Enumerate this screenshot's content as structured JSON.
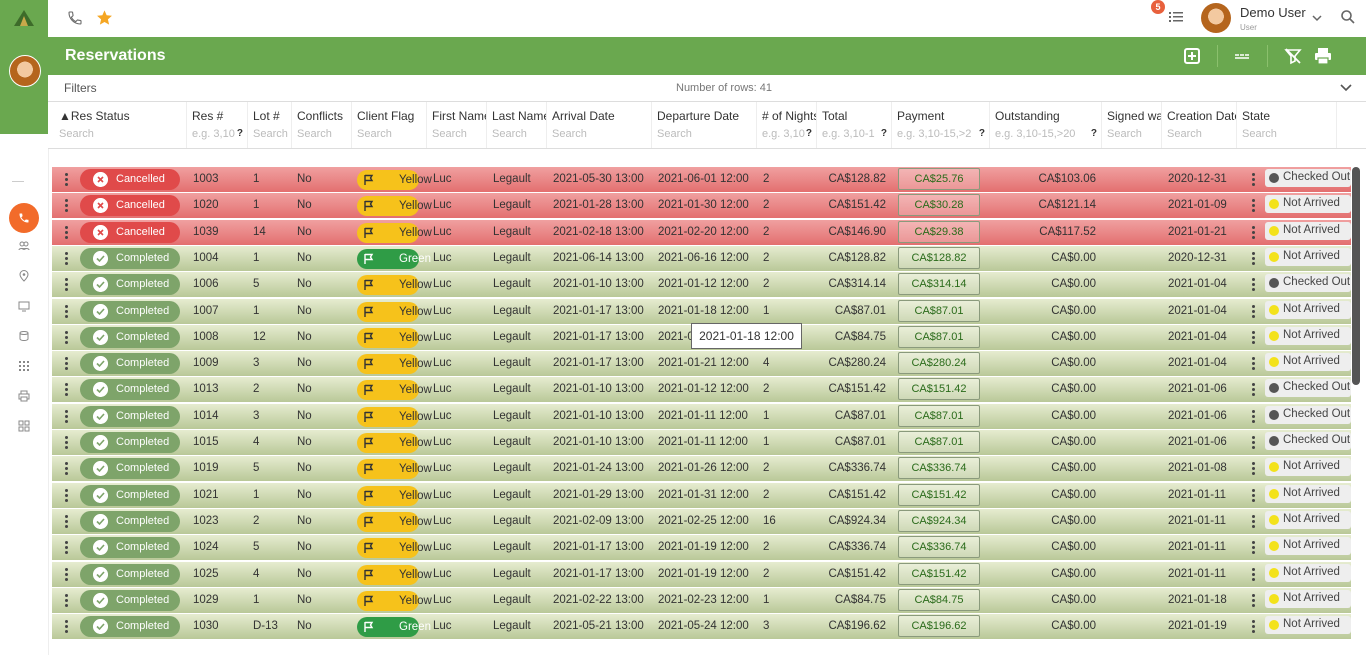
{
  "topbar": {
    "user_name": "Demo User",
    "user_role": "User",
    "notif_count": "5"
  },
  "header": {
    "title": "Reservations"
  },
  "filters": {
    "label": "Filters",
    "row_count": "Number of rows: 41"
  },
  "columns": [
    {
      "label": "▲Res Status",
      "placeholder": "Search"
    },
    {
      "label": "Res #",
      "placeholder": "e.g. 3,10",
      "help": "?"
    },
    {
      "label": "Lot #",
      "placeholder": "Search"
    },
    {
      "label": "Conflicts",
      "placeholder": "Search"
    },
    {
      "label": "Client Flag",
      "placeholder": "Search"
    },
    {
      "label": "First Name",
      "placeholder": "Search"
    },
    {
      "label": "Last Name",
      "placeholder": "Search"
    },
    {
      "label": "Arrival Date",
      "placeholder": "Search"
    },
    {
      "label": "Departure Date",
      "placeholder": "Search"
    },
    {
      "label": "# of Nights",
      "placeholder": "e.g. 3,10",
      "help": "?"
    },
    {
      "label": "Total",
      "placeholder": "e.g. 3,10-1",
      "help": "?"
    },
    {
      "label": "Payment",
      "placeholder": "e.g. 3,10-15,>2",
      "help": "?"
    },
    {
      "label": "Outstanding",
      "placeholder": "e.g. 3,10-15,>20",
      "help": "?"
    },
    {
      "label": "Signed wai",
      "placeholder": "Search"
    },
    {
      "label": "Creation Date",
      "placeholder": "Search"
    },
    {
      "label": "State",
      "placeholder": "Search"
    }
  ],
  "rows": [
    {
      "status": "Cancelled",
      "res": "1003",
      "lot": "1",
      "conflicts": "No",
      "flag": "Yellow",
      "first": "Luc",
      "last": "Legault",
      "arrival": "2021-05-30 13:00",
      "departure": "2021-06-01 12:00",
      "nights": "2",
      "total": "CA$128.82",
      "payment": "CA$25.76",
      "outstanding": "CA$103.06",
      "creation": "2020-12-31",
      "state": "Checked Out"
    },
    {
      "status": "Cancelled",
      "res": "1020",
      "lot": "1",
      "conflicts": "No",
      "flag": "Yellow",
      "first": "Luc",
      "last": "Legault",
      "arrival": "2021-01-28 13:00",
      "departure": "2021-01-30 12:00",
      "nights": "2",
      "total": "CA$151.42",
      "payment": "CA$30.28",
      "outstanding": "CA$121.14",
      "creation": "2021-01-09",
      "state": "Not Arrived"
    },
    {
      "status": "Cancelled",
      "res": "1039",
      "lot": "14",
      "conflicts": "No",
      "flag": "Yellow",
      "first": "Luc",
      "last": "Legault",
      "arrival": "2021-02-18 13:00",
      "departure": "2021-02-20 12:00",
      "nights": "2",
      "total": "CA$146.90",
      "payment": "CA$29.38",
      "outstanding": "CA$117.52",
      "creation": "2021-01-21",
      "state": "Not Arrived"
    },
    {
      "status": "Completed",
      "res": "1004",
      "lot": "1",
      "conflicts": "No",
      "flag": "Green",
      "first": "Luc",
      "last": "Legault",
      "arrival": "2021-06-14 13:00",
      "departure": "2021-06-16 12:00",
      "nights": "2",
      "total": "CA$128.82",
      "payment": "CA$128.82",
      "outstanding": "CA$0.00",
      "creation": "2020-12-31",
      "state": "Not Arrived"
    },
    {
      "status": "Completed",
      "res": "1006",
      "lot": "5",
      "conflicts": "No",
      "flag": "Yellow",
      "first": "Luc",
      "last": "Legault",
      "arrival": "2021-01-10 13:00",
      "departure": "2021-01-12 12:00",
      "nights": "2",
      "total": "CA$314.14",
      "payment": "CA$314.14",
      "outstanding": "CA$0.00",
      "creation": "2021-01-04",
      "state": "Checked Out"
    },
    {
      "status": "Completed",
      "res": "1007",
      "lot": "1",
      "conflicts": "No",
      "flag": "Yellow",
      "first": "Luc",
      "last": "Legault",
      "arrival": "2021-01-17 13:00",
      "departure": "2021-01-18 12:00",
      "nights": "1",
      "total": "CA$87.01",
      "payment": "CA$87.01",
      "outstanding": "CA$0.00",
      "creation": "2021-01-04",
      "state": "Not Arrived"
    },
    {
      "status": "Completed",
      "res": "1008",
      "lot": "12",
      "conflicts": "No",
      "flag": "Yellow",
      "first": "Luc",
      "last": "Legault",
      "arrival": "2021-01-17 13:00",
      "departure": "2021-0",
      "nights": "",
      "total": "CA$84.75",
      "payment": "CA$87.01",
      "outstanding": "CA$0.00",
      "creation": "2021-01-04",
      "state": "Not Arrived"
    },
    {
      "status": "Completed",
      "res": "1009",
      "lot": "3",
      "conflicts": "No",
      "flag": "Yellow",
      "first": "Luc",
      "last": "Legault",
      "arrival": "2021-01-17 13:00",
      "departure": "2021-01-21 12:00",
      "nights": "4",
      "total": "CA$280.24",
      "payment": "CA$280.24",
      "outstanding": "CA$0.00",
      "creation": "2021-01-04",
      "state": "Not Arrived"
    },
    {
      "status": "Completed",
      "res": "1013",
      "lot": "2",
      "conflicts": "No",
      "flag": "Yellow",
      "first": "Luc",
      "last": "Legault",
      "arrival": "2021-01-10 13:00",
      "departure": "2021-01-12 12:00",
      "nights": "2",
      "total": "CA$151.42",
      "payment": "CA$151.42",
      "outstanding": "CA$0.00",
      "creation": "2021-01-06",
      "state": "Checked Out"
    },
    {
      "status": "Completed",
      "res": "1014",
      "lot": "3",
      "conflicts": "No",
      "flag": "Yellow",
      "first": "Luc",
      "last": "Legault",
      "arrival": "2021-01-10 13:00",
      "departure": "2021-01-11 12:00",
      "nights": "1",
      "total": "CA$87.01",
      "payment": "CA$87.01",
      "outstanding": "CA$0.00",
      "creation": "2021-01-06",
      "state": "Checked Out"
    },
    {
      "status": "Completed",
      "res": "1015",
      "lot": "4",
      "conflicts": "No",
      "flag": "Yellow",
      "first": "Luc",
      "last": "Legault",
      "arrival": "2021-01-10 13:00",
      "departure": "2021-01-11 12:00",
      "nights": "1",
      "total": "CA$87.01",
      "payment": "CA$87.01",
      "outstanding": "CA$0.00",
      "creation": "2021-01-06",
      "state": "Checked Out"
    },
    {
      "status": "Completed",
      "res": "1019",
      "lot": "5",
      "conflicts": "No",
      "flag": "Yellow",
      "first": "Luc",
      "last": "Legault",
      "arrival": "2021-01-24 13:00",
      "departure": "2021-01-26 12:00",
      "nights": "2",
      "total": "CA$336.74",
      "payment": "CA$336.74",
      "outstanding": "CA$0.00",
      "creation": "2021-01-08",
      "state": "Not Arrived"
    },
    {
      "status": "Completed",
      "res": "1021",
      "lot": "1",
      "conflicts": "No",
      "flag": "Yellow",
      "first": "Luc",
      "last": "Legault",
      "arrival": "2021-01-29 13:00",
      "departure": "2021-01-31 12:00",
      "nights": "2",
      "total": "CA$151.42",
      "payment": "CA$151.42",
      "outstanding": "CA$0.00",
      "creation": "2021-01-11",
      "state": "Not Arrived"
    },
    {
      "status": "Completed",
      "res": "1023",
      "lot": "2",
      "conflicts": "No",
      "flag": "Yellow",
      "first": "Luc",
      "last": "Legault",
      "arrival": "2021-02-09 13:00",
      "departure": "2021-02-25 12:00",
      "nights": "16",
      "total": "CA$924.34",
      "payment": "CA$924.34",
      "outstanding": "CA$0.00",
      "creation": "2021-01-11",
      "state": "Not Arrived"
    },
    {
      "status": "Completed",
      "res": "1024",
      "lot": "5",
      "conflicts": "No",
      "flag": "Yellow",
      "first": "Luc",
      "last": "Legault",
      "arrival": "2021-01-17 13:00",
      "departure": "2021-01-19 12:00",
      "nights": "2",
      "total": "CA$336.74",
      "payment": "CA$336.74",
      "outstanding": "CA$0.00",
      "creation": "2021-01-11",
      "state": "Not Arrived"
    },
    {
      "status": "Completed",
      "res": "1025",
      "lot": "4",
      "conflicts": "No",
      "flag": "Yellow",
      "first": "Luc",
      "last": "Legault",
      "arrival": "2021-01-17 13:00",
      "departure": "2021-01-19 12:00",
      "nights": "2",
      "total": "CA$151.42",
      "payment": "CA$151.42",
      "outstanding": "CA$0.00",
      "creation": "2021-01-11",
      "state": "Not Arrived"
    },
    {
      "status": "Completed",
      "res": "1029",
      "lot": "1",
      "conflicts": "No",
      "flag": "Yellow",
      "first": "Luc",
      "last": "Legault",
      "arrival": "2021-02-22 13:00",
      "departure": "2021-02-23 12:00",
      "nights": "1",
      "total": "CA$84.75",
      "payment": "CA$84.75",
      "outstanding": "CA$0.00",
      "creation": "2021-01-18",
      "state": "Not Arrived"
    },
    {
      "status": "Completed",
      "res": "1030",
      "lot": "D-13",
      "conflicts": "No",
      "flag": "Green",
      "first": "Luc",
      "last": "Legault",
      "arrival": "2021-05-21 13:00",
      "departure": "2021-05-24 12:00",
      "nights": "3",
      "total": "CA$196.62",
      "payment": "CA$196.62",
      "outstanding": "CA$0.00",
      "creation": "2021-01-19",
      "state": "Not Arrived"
    }
  ],
  "tooltip": "2021-01-18 12:00",
  "colors": {
    "green": "#6aa84f",
    "cancel": "#e04a4a",
    "completed": "#7ea46a",
    "yellow_flag": "#f6c21b",
    "green_flag": "#2f9c46"
  }
}
